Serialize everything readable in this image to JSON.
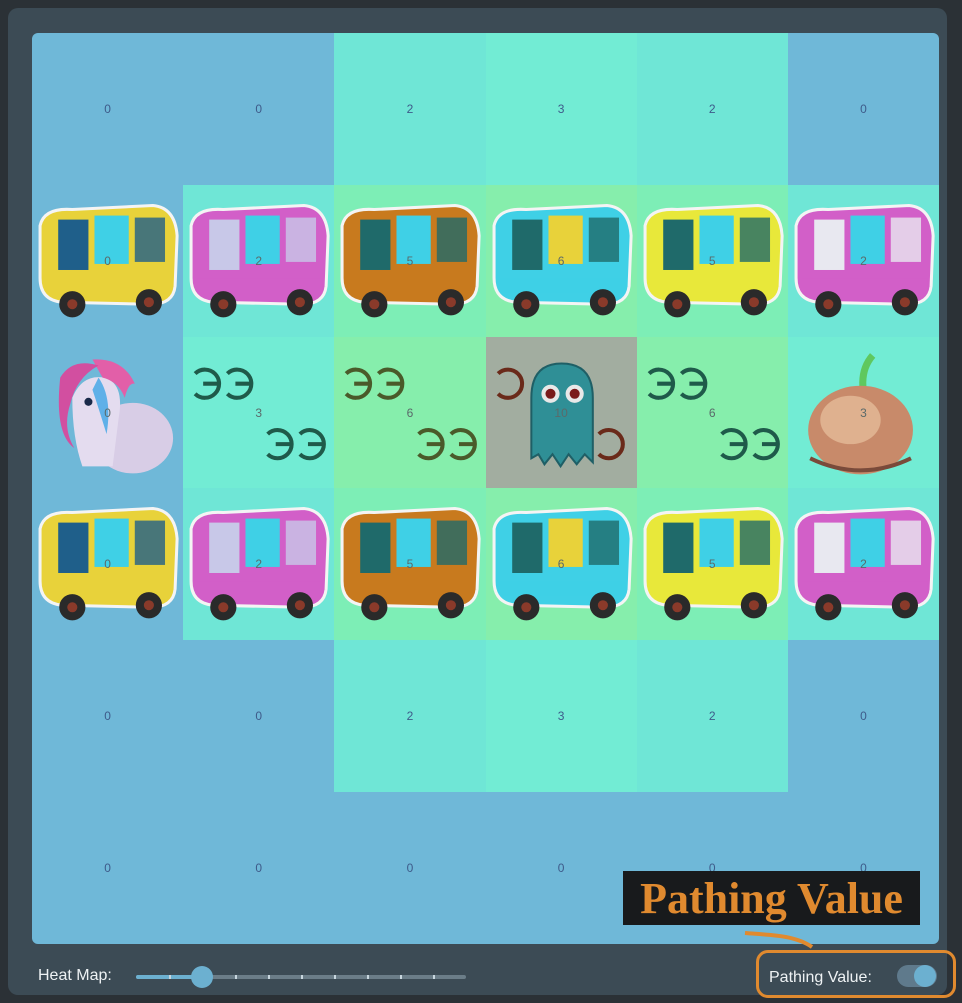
{
  "board": {
    "rows": [
      [
        {
          "value": "0",
          "bg": "#6fb8d8",
          "sprite": ""
        },
        {
          "value": "0",
          "bg": "#6fb8d8",
          "sprite": ""
        },
        {
          "value": "2",
          "bg": "#6fe6d6",
          "sprite": ""
        },
        {
          "value": "3",
          "bg": "#72ecd4",
          "sprite": ""
        },
        {
          "value": "2",
          "bg": "#6fe6d6",
          "sprite": ""
        },
        {
          "value": "0",
          "bg": "#6fb8d8",
          "sprite": ""
        }
      ],
      [
        {
          "value": "0",
          "bg": "#6fb8d8",
          "sprite": "truck"
        },
        {
          "value": "2",
          "bg": "#6fe6d6",
          "sprite": "truck"
        },
        {
          "value": "5",
          "bg": "#7deeb6",
          "sprite": "truck"
        },
        {
          "value": "6",
          "bg": "#86eeac",
          "sprite": "truck"
        },
        {
          "value": "5",
          "bg": "#7deeb6",
          "sprite": "truck"
        },
        {
          "value": "2",
          "bg": "#6fe6d6",
          "sprite": "truck"
        }
      ],
      [
        {
          "value": "0",
          "bg": "#6fb8d8",
          "sprite": "pony"
        },
        {
          "value": "3",
          "bg": "#72ecd4",
          "sprite": "swirls"
        },
        {
          "value": "6",
          "bg": "#86eeac",
          "sprite": "swirls"
        },
        {
          "value": "10",
          "bg": "#a2ada0",
          "sprite": "ghost"
        },
        {
          "value": "6",
          "bg": "#86eeac",
          "sprite": "swirls"
        },
        {
          "value": "3",
          "bg": "#72ecd4",
          "sprite": "onion"
        }
      ],
      [
        {
          "value": "0",
          "bg": "#6fb8d8",
          "sprite": "truck"
        },
        {
          "value": "2",
          "bg": "#6fe6d6",
          "sprite": "truck"
        },
        {
          "value": "5",
          "bg": "#7deeb6",
          "sprite": "truck"
        },
        {
          "value": "6",
          "bg": "#86eeac",
          "sprite": "truck"
        },
        {
          "value": "5",
          "bg": "#7deeb6",
          "sprite": "truck"
        },
        {
          "value": "2",
          "bg": "#6fe6d6",
          "sprite": "truck"
        }
      ],
      [
        {
          "value": "0",
          "bg": "#6fb8d8",
          "sprite": ""
        },
        {
          "value": "0",
          "bg": "#6fb8d8",
          "sprite": ""
        },
        {
          "value": "2",
          "bg": "#6fe6d6",
          "sprite": ""
        },
        {
          "value": "3",
          "bg": "#72ecd4",
          "sprite": ""
        },
        {
          "value": "2",
          "bg": "#6fe6d6",
          "sprite": ""
        },
        {
          "value": "0",
          "bg": "#6fb8d8",
          "sprite": ""
        }
      ],
      [
        {
          "value": "0",
          "bg": "#6fb8d8",
          "sprite": ""
        },
        {
          "value": "0",
          "bg": "#6fb8d8",
          "sprite": ""
        },
        {
          "value": "0",
          "bg": "#6fb8d8",
          "sprite": ""
        },
        {
          "value": "0",
          "bg": "#6fb8d8",
          "sprite": ""
        },
        {
          "value": "0",
          "bg": "#6fb8d8",
          "sprite": ""
        },
        {
          "value": "0",
          "bg": "#6fb8d8",
          "sprite": ""
        }
      ]
    ],
    "truck_palettes": [
      [
        "#e8d23a",
        "#1f5f8a",
        "#3fd0e6",
        "#2a2a2a"
      ],
      [
        "#d25fc8",
        "#c8c8e8",
        "#3fd0e6",
        "#2a2a2a"
      ],
      [
        "#c87a1e",
        "#1f6a6a",
        "#3fd0e6",
        "#2a2a2a"
      ],
      [
        "#3fd0e6",
        "#1f6a6a",
        "#e8d23a",
        "#2a2a2a"
      ],
      [
        "#e8e83a",
        "#1f6a6a",
        "#3fd0e6",
        "#2a2a2a"
      ],
      [
        "#d25fc8",
        "#e8e8f0",
        "#3fd0e6",
        "#2a2a2a"
      ]
    ]
  },
  "callout": {
    "text": "Pathing Value"
  },
  "controls": {
    "heat_map_label": "Heat Map:",
    "heat_map_level": 0.2,
    "heat_map_steps": 10,
    "pathing_value_label": "Pathing Value:",
    "pathing_value_on": true
  },
  "colors": {
    "accent": "#6cb0d0",
    "callout": "#e08a2f"
  }
}
